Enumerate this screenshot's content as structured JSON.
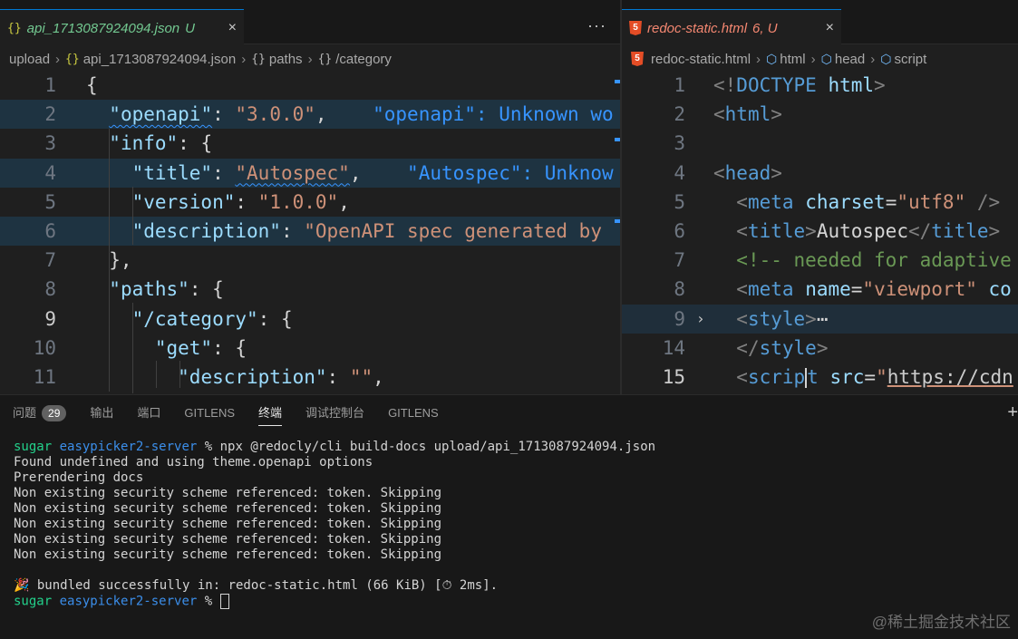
{
  "left_editor": {
    "tab": {
      "name": "api_1713087924094.json",
      "status": "U",
      "close": "×"
    },
    "more": "···",
    "breadcrumb": [
      "upload",
      "api_1713087924094.json",
      "paths",
      "/category"
    ],
    "lines": [
      {
        "n": "1",
        "parts": [
          [
            "p",
            "{"
          ]
        ]
      },
      {
        "n": "2",
        "parts": [
          [
            "p",
            "  "
          ],
          [
            "k",
            "\"openapi\""
          ],
          [
            "p",
            ": "
          ],
          [
            "s",
            "\"3.0.0\""
          ],
          [
            "p",
            ",    "
          ],
          [
            "hint",
            "\"openapi\": Unknown wo"
          ]
        ]
      },
      {
        "n": "3",
        "parts": [
          [
            "p",
            "  "
          ],
          [
            "k",
            "\"info\""
          ],
          [
            "p",
            ": {"
          ]
        ]
      },
      {
        "n": "4",
        "parts": [
          [
            "p",
            "    "
          ],
          [
            "k",
            "\"title\""
          ],
          [
            "p",
            ": "
          ],
          [
            "s",
            "\"Autospec\""
          ],
          [
            "p",
            ",    "
          ],
          [
            "hint",
            "\"Autospec\": Unknow"
          ]
        ]
      },
      {
        "n": "5",
        "parts": [
          [
            "p",
            "    "
          ],
          [
            "k",
            "\"version\""
          ],
          [
            "p",
            ": "
          ],
          [
            "s",
            "\"1.0.0\""
          ],
          [
            "p",
            ","
          ]
        ]
      },
      {
        "n": "6",
        "parts": [
          [
            "p",
            "    "
          ],
          [
            "k",
            "\"description\""
          ],
          [
            "p",
            ": "
          ],
          [
            "s",
            "\"OpenAPI spec generated by"
          ]
        ]
      },
      {
        "n": "7",
        "parts": [
          [
            "p",
            "  },"
          ]
        ]
      },
      {
        "n": "8",
        "parts": [
          [
            "p",
            "  "
          ],
          [
            "k",
            "\"paths\""
          ],
          [
            "p",
            ": {"
          ]
        ]
      },
      {
        "n": "9",
        "parts": [
          [
            "p",
            "    "
          ],
          [
            "k",
            "\"/category\""
          ],
          [
            "p",
            ": {"
          ]
        ]
      },
      {
        "n": "10",
        "parts": [
          [
            "p",
            "      "
          ],
          [
            "k",
            "\"get\""
          ],
          [
            "p",
            ": {"
          ]
        ]
      },
      {
        "n": "11",
        "parts": [
          [
            "p",
            "        "
          ],
          [
            "k",
            "\"description\""
          ],
          [
            "p",
            ": "
          ],
          [
            "s",
            "\"\""
          ],
          [
            "p",
            ","
          ]
        ]
      }
    ]
  },
  "right_editor": {
    "tab": {
      "icon": "5",
      "name": "redoc-static.html",
      "status": "6, U",
      "close": "×"
    },
    "breadcrumb": [
      "redoc-static.html",
      "html",
      "head",
      "script"
    ],
    "lines": [
      {
        "n": "1",
        "parts": [
          [
            "tag",
            "<!"
          ],
          [
            "tn",
            "DOCTYPE"
          ],
          [
            "plain",
            " "
          ],
          [
            "an",
            "html"
          ],
          [
            "tag",
            ">"
          ]
        ]
      },
      {
        "n": "2",
        "parts": [
          [
            "tag",
            "<"
          ],
          [
            "tn",
            "html"
          ],
          [
            "tag",
            ">"
          ]
        ]
      },
      {
        "n": "3",
        "parts": []
      },
      {
        "n": "4",
        "parts": [
          [
            "tag",
            "<"
          ],
          [
            "tn",
            "head"
          ],
          [
            "tag",
            ">"
          ]
        ]
      },
      {
        "n": "5",
        "parts": [
          [
            "plain",
            "  "
          ],
          [
            "tag",
            "<"
          ],
          [
            "tn",
            "meta"
          ],
          [
            "plain",
            " "
          ],
          [
            "an",
            "charset"
          ],
          [
            "plain",
            "="
          ],
          [
            "s",
            "\"utf8\""
          ],
          [
            "plain",
            " "
          ],
          [
            "tag",
            "/>"
          ]
        ]
      },
      {
        "n": "6",
        "parts": [
          [
            "plain",
            "  "
          ],
          [
            "tag",
            "<"
          ],
          [
            "tn",
            "title"
          ],
          [
            "tag",
            ">"
          ],
          [
            "plain",
            "Autospec"
          ],
          [
            "tag",
            "</"
          ],
          [
            "tn",
            "title"
          ],
          [
            "tag",
            ">"
          ]
        ]
      },
      {
        "n": "7",
        "parts": [
          [
            "plain",
            "  "
          ],
          [
            "cm",
            "<!-- needed for adaptive"
          ]
        ]
      },
      {
        "n": "8",
        "parts": [
          [
            "plain",
            "  "
          ],
          [
            "tag",
            "<"
          ],
          [
            "tn",
            "meta"
          ],
          [
            "plain",
            " "
          ],
          [
            "an",
            "name"
          ],
          [
            "plain",
            "="
          ],
          [
            "s",
            "\"viewport\""
          ],
          [
            "plain",
            " "
          ],
          [
            "an",
            "co"
          ]
        ]
      },
      {
        "n": "9",
        "parts": [
          [
            "plain",
            "  "
          ],
          [
            "tag",
            "<"
          ],
          [
            "tn",
            "style"
          ],
          [
            "tag",
            ">"
          ],
          [
            "plain",
            "⋯"
          ]
        ]
      },
      {
        "n": "14",
        "parts": [
          [
            "plain",
            "  "
          ],
          [
            "tag",
            "</"
          ],
          [
            "tn",
            "style"
          ],
          [
            "tag",
            ">"
          ]
        ]
      },
      {
        "n": "15",
        "parts": [
          [
            "plain",
            "  "
          ],
          [
            "tag",
            "<"
          ],
          [
            "tn",
            "scrip"
          ],
          [
            "cursor",
            ""
          ],
          [
            "tn",
            "t"
          ],
          [
            "plain",
            " "
          ],
          [
            "an",
            "src"
          ],
          [
            "plain",
            "="
          ],
          [
            "s",
            "\""
          ],
          [
            "url",
            "https://cdn"
          ]
        ]
      }
    ]
  },
  "panel": {
    "tabs": [
      {
        "label": "问题",
        "badge": "29"
      },
      {
        "label": "输出"
      },
      {
        "label": "端口"
      },
      {
        "label": "GITLENS"
      },
      {
        "label": "终端",
        "active": true
      },
      {
        "label": "调试控制台"
      },
      {
        "label": "GITLENS"
      }
    ],
    "plus": "+",
    "terminal": {
      "user": "sugar",
      "dir": "easypicker2-server",
      "prompt_symbol": "%",
      "command": "npx @redocly/cli build-docs upload/api_1713087924094.json",
      "output": [
        "Found undefined and using theme.openapi options",
        "Prerendering docs",
        "Non existing security scheme referenced: token. Skipping",
        "Non existing security scheme referenced: token. Skipping",
        "Non existing security scheme referenced: token. Skipping",
        "Non existing security scheme referenced: token. Skipping",
        "Non existing security scheme referenced: token. Skipping"
      ],
      "success": "🎉 bundled successfully in: redoc-static.html (66 KiB) [⏱ 2ms]."
    }
  },
  "watermark": "@稀土掘金技术社区"
}
